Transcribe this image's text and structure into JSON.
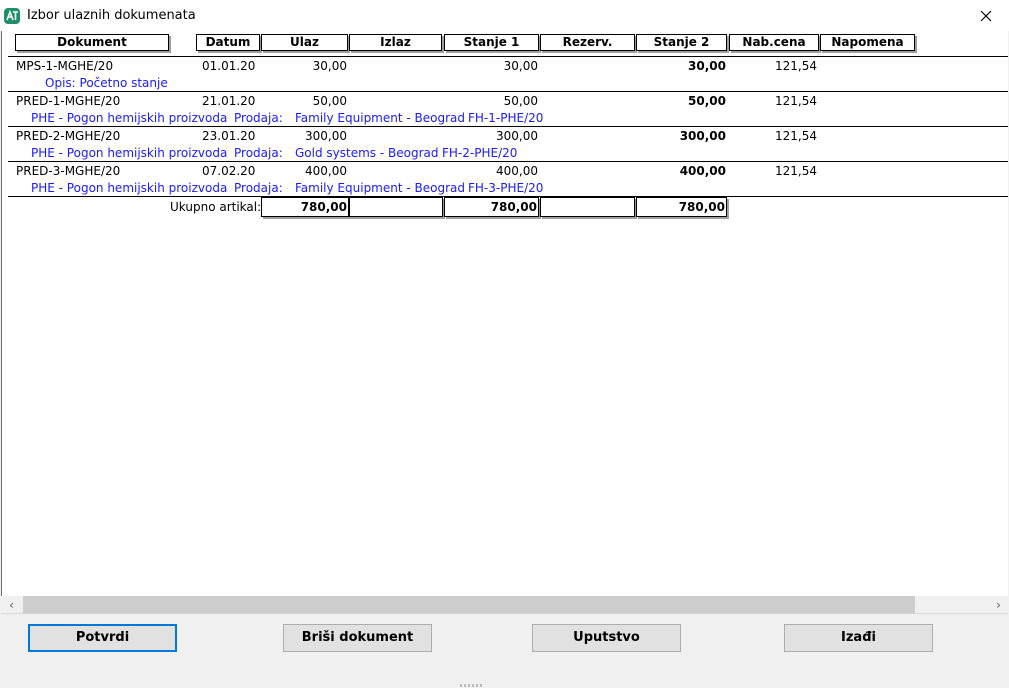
{
  "window": {
    "title": "Izbor ulaznih dokumenata",
    "icon": "app-logo-icon",
    "close_icon": "close-icon"
  },
  "table": {
    "headers": {
      "dokument": "Dokument",
      "datum": "Datum",
      "ulaz": "Ulaz",
      "izlaz": "Izlaz",
      "stanje1": "Stanje 1",
      "rezerv": "Rezerv.",
      "stanje2": "Stanje 2",
      "nabcena": "Nab.cena",
      "napomena": "Napomena"
    },
    "rows": [
      {
        "dokument": "MPS-1-MGHE/20",
        "datum": "01.01.20",
        "ulaz": "30,00",
        "izlaz": "",
        "stanje1": "30,00",
        "rezerv": "",
        "stanje2": "30,00",
        "nabcena": "121,54",
        "sub": {
          "opis": "Opis: Početno stanje"
        }
      },
      {
        "dokument": "PRED-1-MGHE/20",
        "datum": "21.01.20",
        "ulaz": "50,00",
        "izlaz": "",
        "stanje1": "50,00",
        "rezerv": "",
        "stanje2": "50,00",
        "nabcena": "121,54",
        "sub": {
          "pogon": "PHE - Pogon hemijskih proizvoda",
          "prodaja_label": "Prodaja:",
          "kupac": "Family Equipment - Beograd",
          "faktura": "FH-1-PHE/20"
        }
      },
      {
        "dokument": "PRED-2-MGHE/20",
        "datum": "23.01.20",
        "ulaz": "300,00",
        "izlaz": "",
        "stanje1": "300,00",
        "rezerv": "",
        "stanje2": "300,00",
        "nabcena": "121,54",
        "sub": {
          "pogon": "PHE - Pogon hemijskih proizvoda",
          "prodaja_label": "Prodaja:",
          "kupac": "Gold systems - Beograd",
          "faktura": "FH-2-PHE/20"
        }
      },
      {
        "dokument": "PRED-3-MGHE/20",
        "datum": "07.02.20",
        "ulaz": "400,00",
        "izlaz": "",
        "stanje1": "400,00",
        "rezerv": "",
        "stanje2": "400,00",
        "nabcena": "121,54",
        "sub": {
          "pogon": "PHE - Pogon hemijskih proizvoda",
          "prodaja_label": "Prodaja:",
          "kupac": "Family Equipment - Beograd",
          "faktura": "FH-3-PHE/20"
        }
      }
    ],
    "totals": {
      "label": "Ukupno artikal:",
      "ulaz": "780,00",
      "izlaz": "",
      "stanje1": "780,00",
      "rezerv": "",
      "stanje2": "780,00"
    }
  },
  "scrollbar": {
    "left_icon": "chevron-left-icon",
    "right_icon": "chevron-right-icon"
  },
  "buttons": {
    "potvrdi": "Potvrdi",
    "brisi": "Briši dokument",
    "uputstvo": "Uputstvo",
    "izadji": "Izađi"
  },
  "colors": {
    "accent": "#0078d7",
    "link_text": "#1a1aff",
    "app_icon": "#1f8f6a"
  }
}
